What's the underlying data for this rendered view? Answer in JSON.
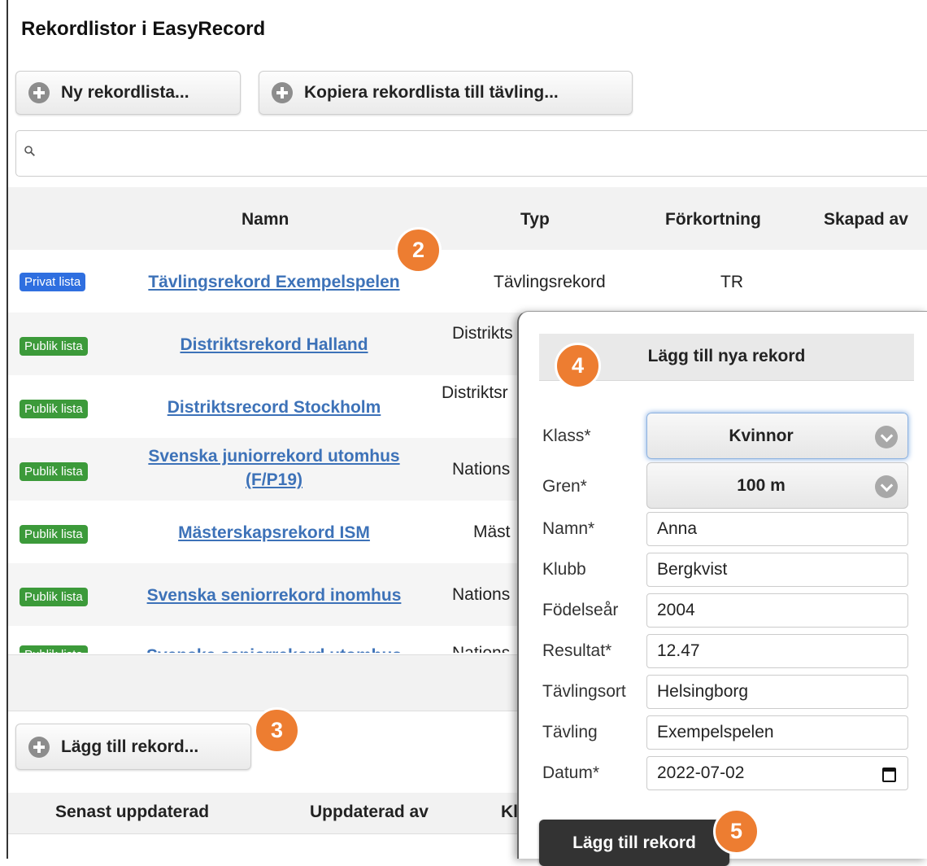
{
  "page": {
    "title": "Rekordlistor i EasyRecord"
  },
  "toolbar": {
    "new_list_label": "Ny rekordlista...",
    "copy_list_label": "Kopiera rekordlista till tävling..."
  },
  "search": {
    "placeholder": "",
    "value": ""
  },
  "table": {
    "columns": [
      "Namn",
      "Typ",
      "Förkortning",
      "Skapad av"
    ],
    "rows": [
      {
        "badge": "Privat lista",
        "badge_kind": "private",
        "name": "Tävlingsrekord Exempelspelen",
        "type": "Tävlingsrekord",
        "abbr": "TR"
      },
      {
        "badge": "Publik lista",
        "badge_kind": "public",
        "name": "Distriktsrekord Halland",
        "type": "Distrikts"
      },
      {
        "badge": "Publik lista",
        "badge_kind": "public",
        "name": "Distriktsrecord Stockholm",
        "type": "Distriktsr"
      },
      {
        "badge": "Publik lista",
        "badge_kind": "public",
        "name_line1": "Svenska juniorrekord utomhus",
        "name_line2": "(F/P19)",
        "type": "Nations"
      },
      {
        "badge": "Publik lista",
        "badge_kind": "public",
        "name": "Mästerskapsrekord ISM",
        "type": "Mäst"
      },
      {
        "badge": "Publik lista",
        "badge_kind": "public",
        "name": "Svenska seniorrekord inomhus",
        "type": "Nations"
      },
      {
        "badge": "Publik lista",
        "badge_kind": "public",
        "name": "Svenska seniorrekord utomhus",
        "type": "Nations"
      }
    ]
  },
  "records": {
    "add_button_label": "Lägg till rekord...",
    "columns": [
      "Senast uppdaterad",
      "Uppdaterad av",
      "Kl"
    ]
  },
  "popup": {
    "title": "Lägg till nya rekord",
    "fields": {
      "klass": {
        "label": "Klass*",
        "value": "Kvinnor"
      },
      "gren": {
        "label": "Gren*",
        "value": "100 m"
      },
      "namn": {
        "label": "Namn*",
        "value": "Anna"
      },
      "klubb": {
        "label": "Klubb",
        "value": "Bergkvist"
      },
      "fodelsear": {
        "label": "Födelseår",
        "value": "2004"
      },
      "resultat": {
        "label": "Resultat*",
        "value": "12.47"
      },
      "tavlingsort": {
        "label": "Tävlingsort",
        "value": "Helsingborg"
      },
      "tavling": {
        "label": "Tävling",
        "value": "Exempelspelen"
      },
      "datum": {
        "label": "Datum*",
        "value": "2022-07-02"
      }
    },
    "submit_label": "Lägg till rekord"
  },
  "markers": [
    "2",
    "3",
    "4",
    "5"
  ],
  "colors": {
    "marker": "#ed7d31",
    "private_badge": "#2f6fe0",
    "public_badge": "#3c9a3a",
    "link": "#3d72b8",
    "submit_bg": "#333333"
  }
}
